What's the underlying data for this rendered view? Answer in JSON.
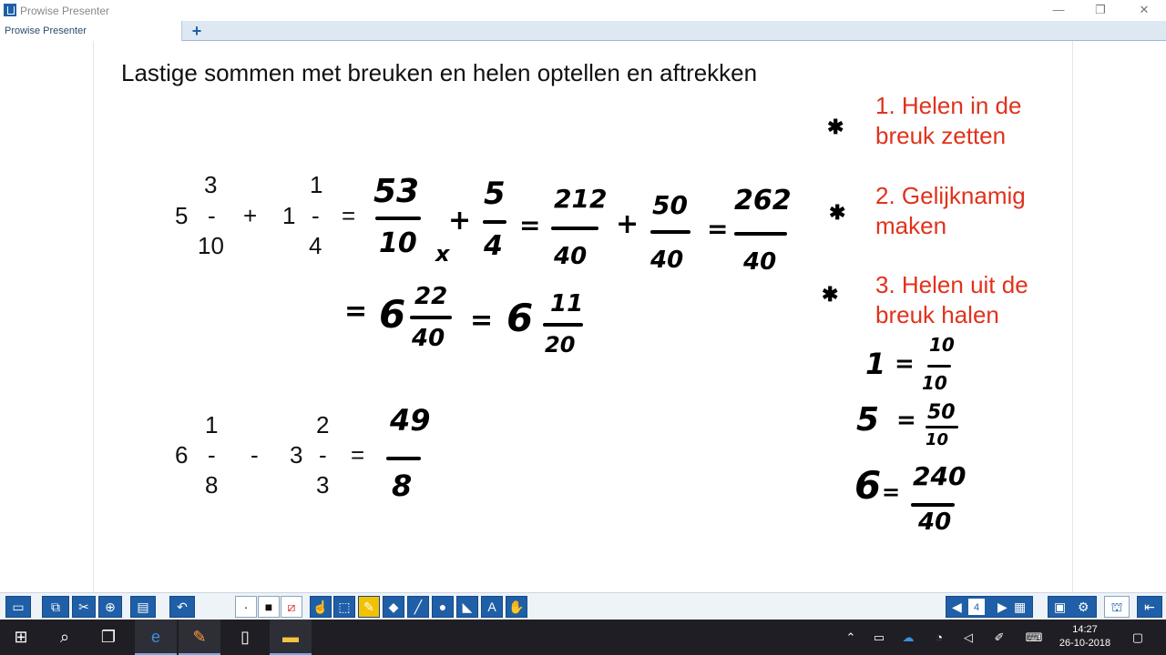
{
  "window": {
    "title": "Prowise Presenter",
    "tab_label": "Prowise Presenter",
    "add_tab": "+",
    "minimize": "—",
    "restore": "❐",
    "close": "✕"
  },
  "slide": {
    "title": "Lastige sommen met breuken en helen optellen en aftrekken",
    "steps": [
      "1. Helen in de",
      "breuk zetten",
      "2. Gelijknamig",
      "maken",
      "3. Helen uit de",
      "breuk halen"
    ],
    "sum1": {
      "whole_a": "5",
      "num_a": "3",
      "dash_a": "-",
      "den_a": "10",
      "op": "+",
      "whole_b": "1",
      "num_b": "1",
      "dash_b": "-",
      "den_b": "4",
      "eq": "="
    },
    "sum2": {
      "whole_a": "6",
      "num_a": "1",
      "dash_a": "-",
      "den_a": "8",
      "op": "-",
      "whole_b": "3",
      "num_b": "2",
      "dash_b": "-",
      "den_b": "3",
      "eq": "="
    },
    "handwriting": {
      "f1_num": "53",
      "f1_den": "10",
      "times": "x",
      "plus1": "+",
      "f2_num": "5",
      "f2_den": "4",
      "eq1": "=",
      "f3_num": "212",
      "f3_den": "40",
      "plus2": "+",
      "f4_num": "50",
      "f4_den": "40",
      "eq2": "=",
      "f5_num": "262",
      "f5_den": "40",
      "eq3": "=",
      "mixed1_whole": "6",
      "mixed1_num": "22",
      "mixed1_den": "40",
      "eq4": "=",
      "mixed2_whole": "6",
      "mixed2_num": "11",
      "mixed2_den": "20",
      "f6_num": "49",
      "f6_den": "8",
      "side1_left": "1",
      "side1_eq": "=",
      "side1_num": "10",
      "side1_den": "10",
      "side2_left": "5",
      "side2_eq": "=",
      "side2_num": "50",
      "side2_den": "10",
      "side3_left": "6",
      "side3_eq": "=",
      "side3_num": "240",
      "side3_den": "40",
      "star": "✱"
    }
  },
  "toolbar": {
    "page_number": "4",
    "icons": [
      "folder-icon",
      "screens-icon",
      "tools-icon",
      "zoom-icon",
      "pages-icon",
      "undo-icon",
      "pen-thin-icon",
      "pen-thick-icon",
      "no-fill-icon",
      "pointer-icon",
      "select-icon",
      "highlighter-icon",
      "eraser-icon",
      "line-icon",
      "circle-icon",
      "ruler-icon",
      "text-icon",
      "hand-icon",
      "prev-page-icon",
      "next-page-icon",
      "grid-icon",
      "display-icon",
      "settings-icon",
      "presentation-icon",
      "exit-icon"
    ]
  },
  "taskbar": {
    "time": "14:27",
    "date": "26-10-2018"
  }
}
